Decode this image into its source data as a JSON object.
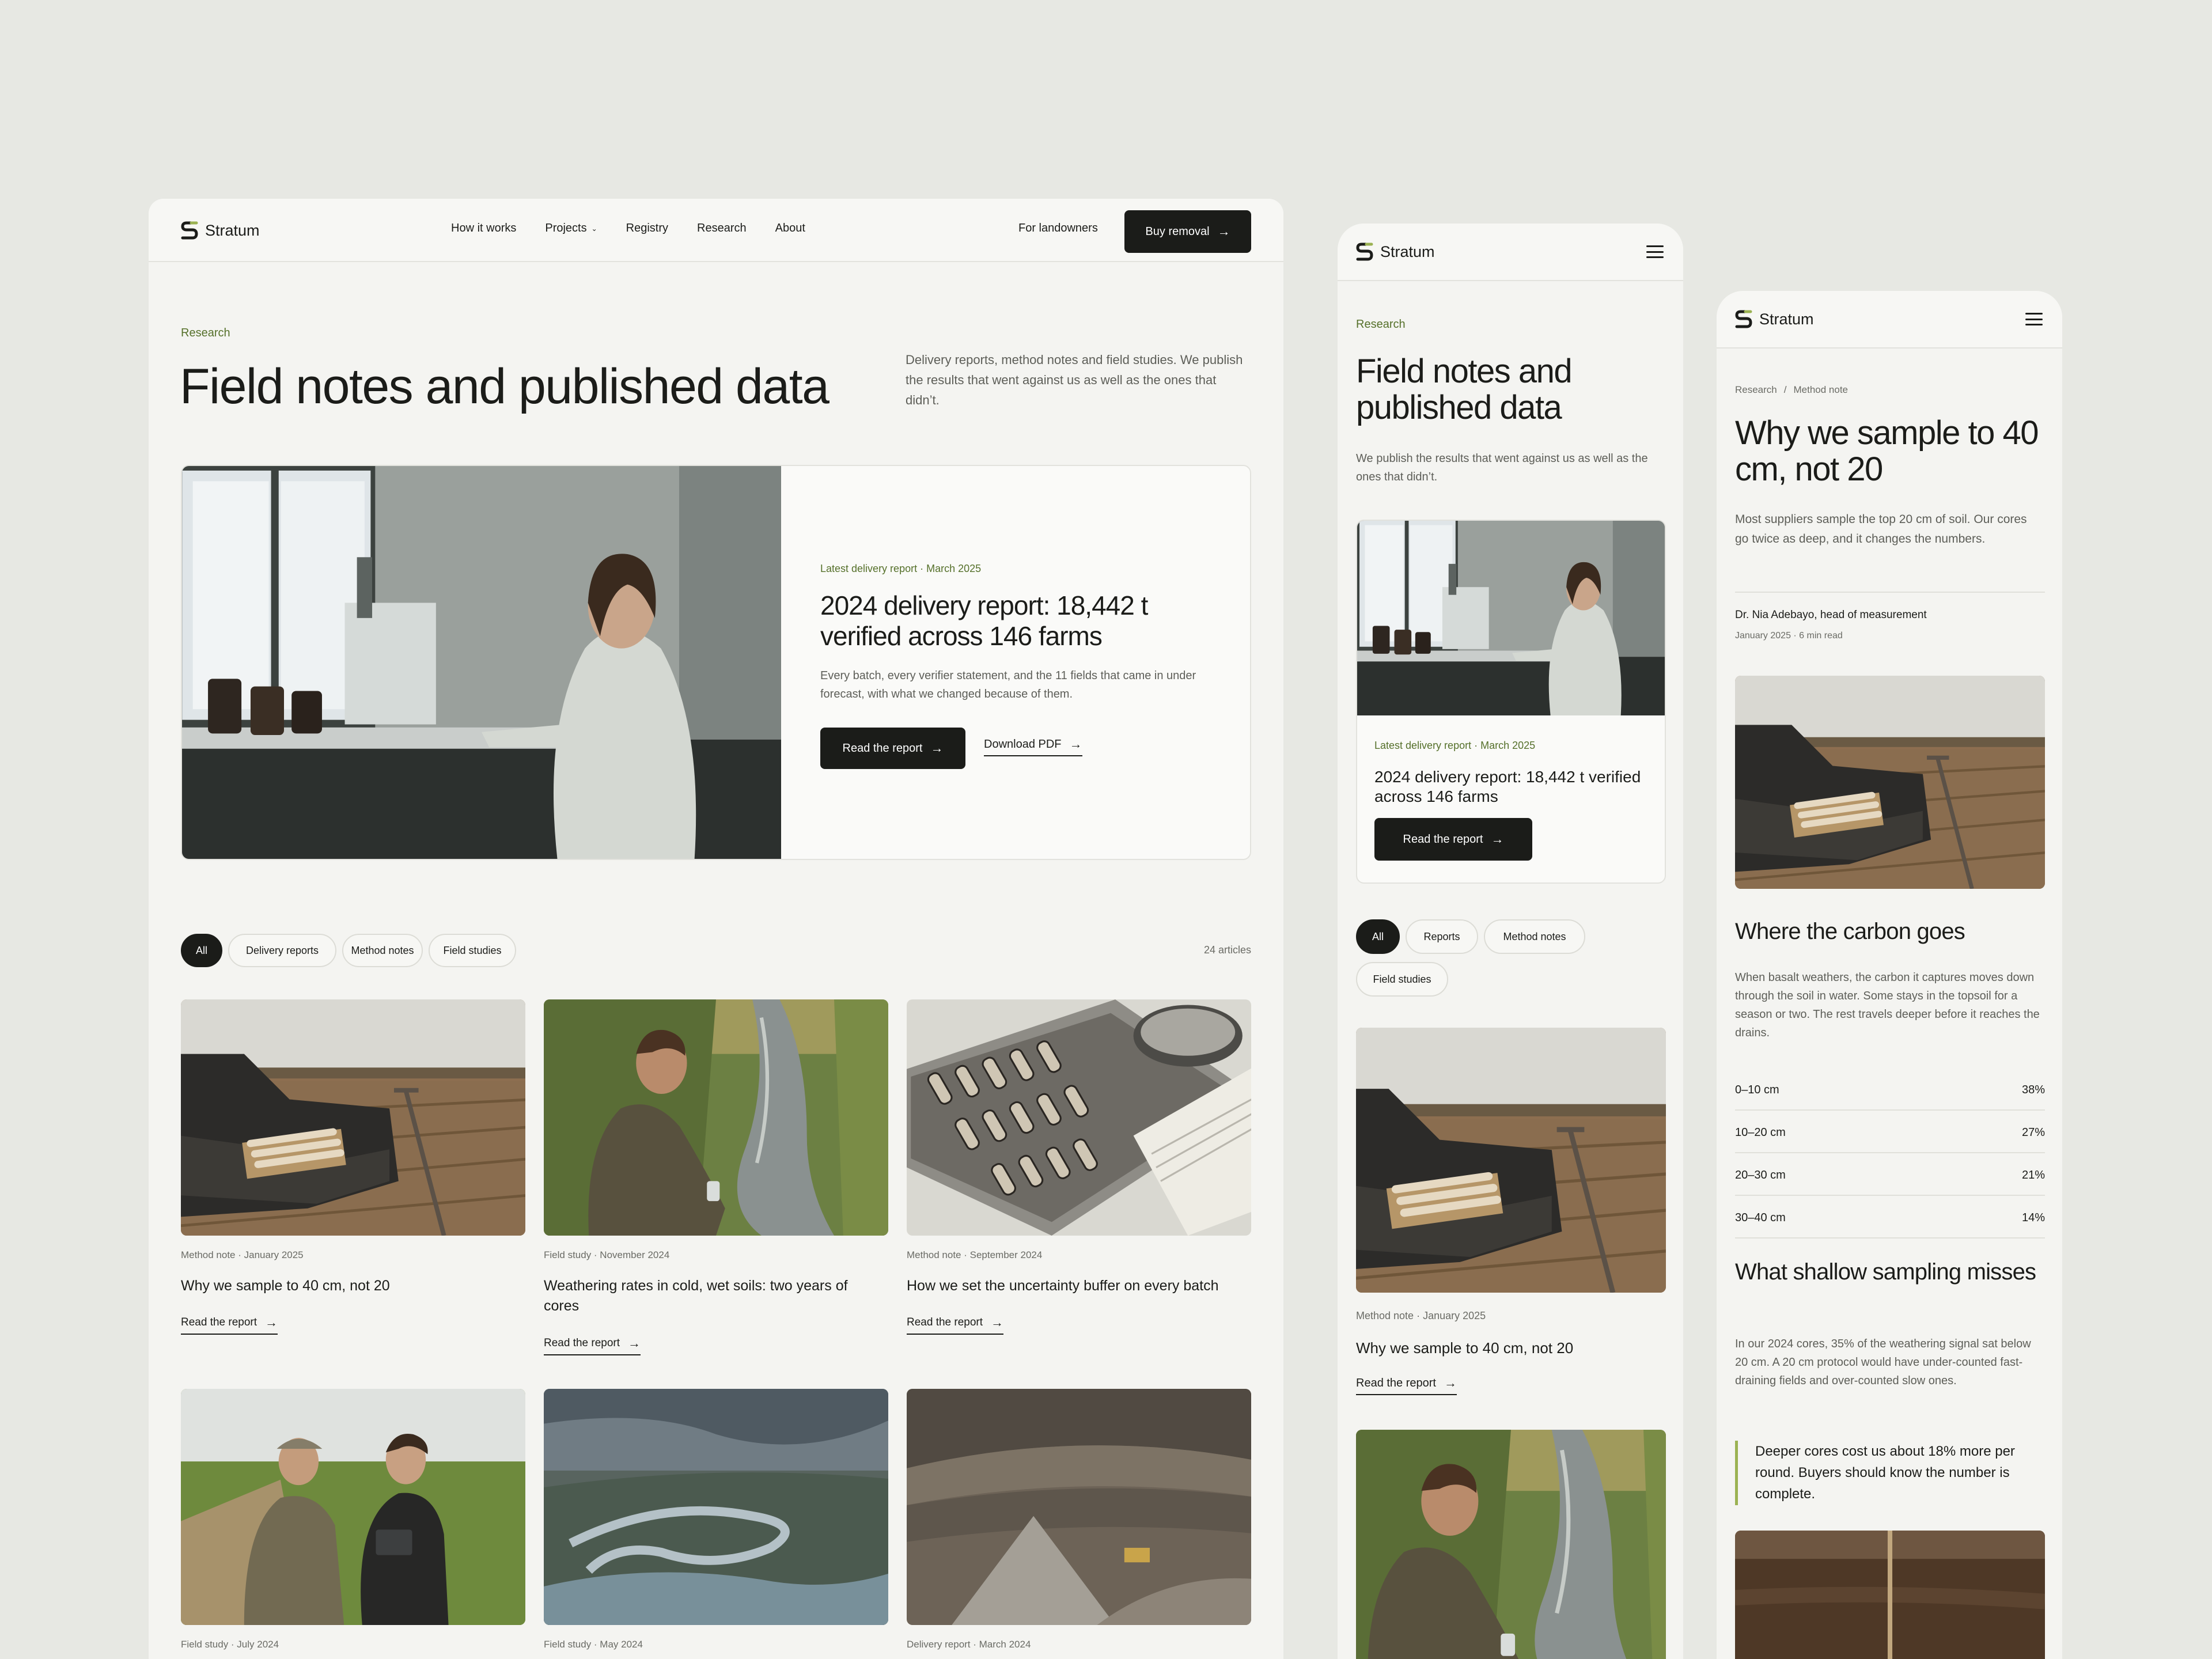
{
  "brand": "Stratum",
  "nav": {
    "items": [
      "How it works",
      "Projects",
      "Registry",
      "Research",
      "About"
    ],
    "for_landowners": "For landowners",
    "cta": "Buy removal"
  },
  "page": {
    "eyebrow": "Research",
    "title": "Field notes and published data",
    "intro": "Delivery reports, method notes and field studies. We publish the results that went against us as well as the ones that didn’t.",
    "intro_mobile": "We publish the results that went against us as well as the ones that didn’t."
  },
  "featured": {
    "meta": "Latest delivery report · March 2025",
    "title": "2024 delivery report: 18,442 t verified across 146 farms",
    "body": "Every batch, every verifier statement, and the 11 fields that came in under forecast, with what we changed because of them.",
    "primary": "Read the report",
    "secondary": "Download PDF"
  },
  "filters": {
    "desktop": [
      "All",
      "Delivery reports",
      "Method notes",
      "Field studies"
    ],
    "mobile": [
      "All",
      "Reports",
      "Method notes",
      "Field studies"
    ],
    "count": "24 articles"
  },
  "articles": [
    {
      "meta": "Method note · January 2025",
      "title": "Why we sample to 40 cm, not 20",
      "link": "Read the report"
    },
    {
      "meta": "Field study · November 2024",
      "title": "Weathering rates in cold, wet soils: two years of cores",
      "link": "Read the report"
    },
    {
      "meta": "Method note · September 2024",
      "title": "How we set the uncertainty buffer on every batch",
      "link": "Read the report"
    },
    {
      "meta": "Field study · July 2024"
    },
    {
      "meta": "Field study · May 2024"
    },
    {
      "meta": "Delivery report · March 2024"
    }
  ],
  "article_page": {
    "breadcrumb": [
      "Research",
      "Method note"
    ],
    "title": "Why we sample to 40 cm, not 20",
    "lede": "Most suppliers sample the top 20 cm of soil. Our cores go twice as deep, and it changes the numbers.",
    "author": "Dr. Nia Adebayo, head of measurement",
    "date": "January 2025 · 6 min read",
    "h2a": "Where the carbon goes",
    "p1": "When basalt weathers, the carbon it captures moves down through the soil in water. Some stays in the topsoil for a season or two. The rest travels deeper before it reaches the drains.",
    "depths": [
      {
        "label": "0–10 cm",
        "value": "38%"
      },
      {
        "label": "10–20 cm",
        "value": "27%"
      },
      {
        "label": "20–30 cm",
        "value": "21%"
      },
      {
        "label": "30–40 cm",
        "value": "14%"
      }
    ],
    "h2b": "What shallow sampling misses",
    "p2": "In our 2024 cores, 35% of the weathering signal sat below 20 cm. A 20 cm protocol would have under-counted fast-draining fields and over-counted slow ones.",
    "quote": "Deeper cores cost us about 18% more per round. Buyers should know the number is complete."
  }
}
